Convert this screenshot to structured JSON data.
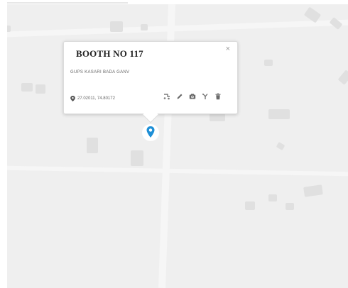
{
  "popup": {
    "title": "BOOTH NO 117",
    "subtitle": "GUPS KASARI BADA GANV",
    "close_symbol": "×",
    "coordinates": "27.02011, 74.80172"
  },
  "colors": {
    "map_background": "#efefef",
    "marker_blue": "#1e8fd6",
    "icon_gray": "#7a7a7a"
  },
  "toolbar": {
    "icons": [
      "route-icon",
      "edit-icon",
      "camera-icon",
      "fork-icon",
      "delete-icon"
    ]
  },
  "marker": {
    "icon": "map-pin-icon"
  }
}
